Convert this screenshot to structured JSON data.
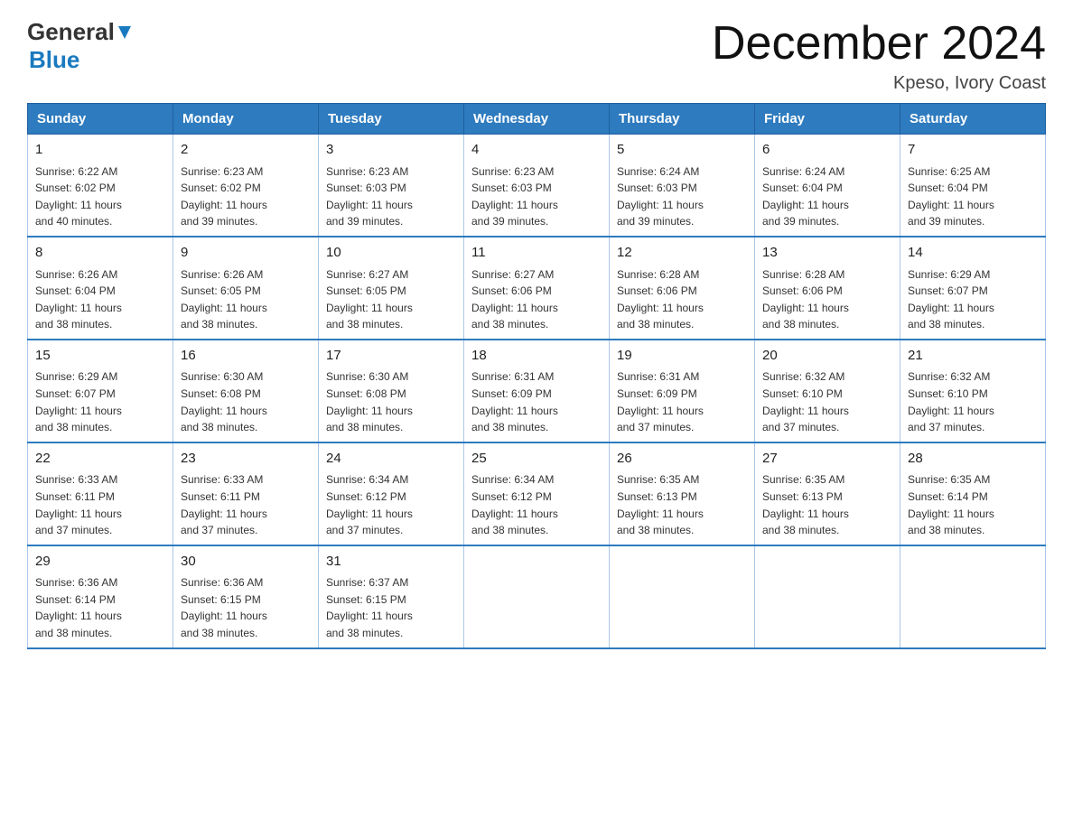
{
  "header": {
    "logo_general": "General",
    "logo_blue": "Blue",
    "month_title": "December 2024",
    "location": "Kpeso, Ivory Coast"
  },
  "days_of_week": [
    "Sunday",
    "Monday",
    "Tuesday",
    "Wednesday",
    "Thursday",
    "Friday",
    "Saturday"
  ],
  "weeks": [
    [
      {
        "day": "1",
        "sunrise": "6:22 AM",
        "sunset": "6:02 PM",
        "daylight": "11 hours and 40 minutes."
      },
      {
        "day": "2",
        "sunrise": "6:23 AM",
        "sunset": "6:02 PM",
        "daylight": "11 hours and 39 minutes."
      },
      {
        "day": "3",
        "sunrise": "6:23 AM",
        "sunset": "6:03 PM",
        "daylight": "11 hours and 39 minutes."
      },
      {
        "day": "4",
        "sunrise": "6:23 AM",
        "sunset": "6:03 PM",
        "daylight": "11 hours and 39 minutes."
      },
      {
        "day": "5",
        "sunrise": "6:24 AM",
        "sunset": "6:03 PM",
        "daylight": "11 hours and 39 minutes."
      },
      {
        "day": "6",
        "sunrise": "6:24 AM",
        "sunset": "6:04 PM",
        "daylight": "11 hours and 39 minutes."
      },
      {
        "day": "7",
        "sunrise": "6:25 AM",
        "sunset": "6:04 PM",
        "daylight": "11 hours and 39 minutes."
      }
    ],
    [
      {
        "day": "8",
        "sunrise": "6:26 AM",
        "sunset": "6:04 PM",
        "daylight": "11 hours and 38 minutes."
      },
      {
        "day": "9",
        "sunrise": "6:26 AM",
        "sunset": "6:05 PM",
        "daylight": "11 hours and 38 minutes."
      },
      {
        "day": "10",
        "sunrise": "6:27 AM",
        "sunset": "6:05 PM",
        "daylight": "11 hours and 38 minutes."
      },
      {
        "day": "11",
        "sunrise": "6:27 AM",
        "sunset": "6:06 PM",
        "daylight": "11 hours and 38 minutes."
      },
      {
        "day": "12",
        "sunrise": "6:28 AM",
        "sunset": "6:06 PM",
        "daylight": "11 hours and 38 minutes."
      },
      {
        "day": "13",
        "sunrise": "6:28 AM",
        "sunset": "6:06 PM",
        "daylight": "11 hours and 38 minutes."
      },
      {
        "day": "14",
        "sunrise": "6:29 AM",
        "sunset": "6:07 PM",
        "daylight": "11 hours and 38 minutes."
      }
    ],
    [
      {
        "day": "15",
        "sunrise": "6:29 AM",
        "sunset": "6:07 PM",
        "daylight": "11 hours and 38 minutes."
      },
      {
        "day": "16",
        "sunrise": "6:30 AM",
        "sunset": "6:08 PM",
        "daylight": "11 hours and 38 minutes."
      },
      {
        "day": "17",
        "sunrise": "6:30 AM",
        "sunset": "6:08 PM",
        "daylight": "11 hours and 38 minutes."
      },
      {
        "day": "18",
        "sunrise": "6:31 AM",
        "sunset": "6:09 PM",
        "daylight": "11 hours and 38 minutes."
      },
      {
        "day": "19",
        "sunrise": "6:31 AM",
        "sunset": "6:09 PM",
        "daylight": "11 hours and 37 minutes."
      },
      {
        "day": "20",
        "sunrise": "6:32 AM",
        "sunset": "6:10 PM",
        "daylight": "11 hours and 37 minutes."
      },
      {
        "day": "21",
        "sunrise": "6:32 AM",
        "sunset": "6:10 PM",
        "daylight": "11 hours and 37 minutes."
      }
    ],
    [
      {
        "day": "22",
        "sunrise": "6:33 AM",
        "sunset": "6:11 PM",
        "daylight": "11 hours and 37 minutes."
      },
      {
        "day": "23",
        "sunrise": "6:33 AM",
        "sunset": "6:11 PM",
        "daylight": "11 hours and 37 minutes."
      },
      {
        "day": "24",
        "sunrise": "6:34 AM",
        "sunset": "6:12 PM",
        "daylight": "11 hours and 37 minutes."
      },
      {
        "day": "25",
        "sunrise": "6:34 AM",
        "sunset": "6:12 PM",
        "daylight": "11 hours and 38 minutes."
      },
      {
        "day": "26",
        "sunrise": "6:35 AM",
        "sunset": "6:13 PM",
        "daylight": "11 hours and 38 minutes."
      },
      {
        "day": "27",
        "sunrise": "6:35 AM",
        "sunset": "6:13 PM",
        "daylight": "11 hours and 38 minutes."
      },
      {
        "day": "28",
        "sunrise": "6:35 AM",
        "sunset": "6:14 PM",
        "daylight": "11 hours and 38 minutes."
      }
    ],
    [
      {
        "day": "29",
        "sunrise": "6:36 AM",
        "sunset": "6:14 PM",
        "daylight": "11 hours and 38 minutes."
      },
      {
        "day": "30",
        "sunrise": "6:36 AM",
        "sunset": "6:15 PM",
        "daylight": "11 hours and 38 minutes."
      },
      {
        "day": "31",
        "sunrise": "6:37 AM",
        "sunset": "6:15 PM",
        "daylight": "11 hours and 38 minutes."
      },
      {
        "day": "",
        "sunrise": "",
        "sunset": "",
        "daylight": ""
      },
      {
        "day": "",
        "sunrise": "",
        "sunset": "",
        "daylight": ""
      },
      {
        "day": "",
        "sunrise": "",
        "sunset": "",
        "daylight": ""
      },
      {
        "day": "",
        "sunrise": "",
        "sunset": "",
        "daylight": ""
      }
    ]
  ],
  "cell_labels": {
    "sunrise": "Sunrise: ",
    "sunset": "Sunset: ",
    "daylight": "Daylight: "
  }
}
